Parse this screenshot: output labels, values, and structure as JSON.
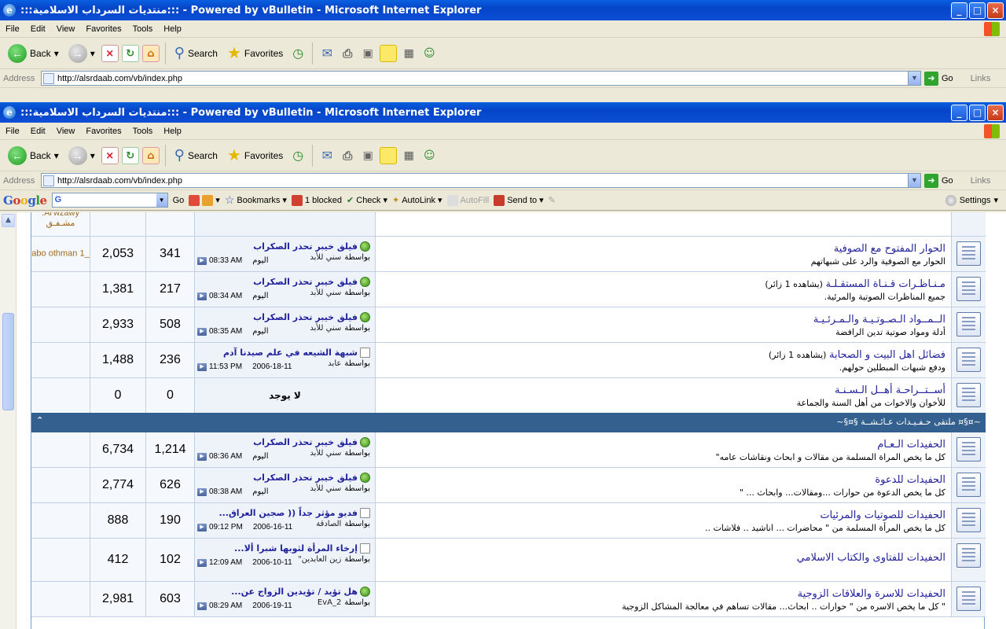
{
  "window": {
    "title": ":::منتديات السرداب الاسلامية::: - Powered by vBulletin - Microsoft Internet Explorer",
    "controls": {
      "minimize": "_",
      "maximize": "□",
      "close": "×"
    }
  },
  "menu": [
    "File",
    "Edit",
    "View",
    "Favorites",
    "Tools",
    "Help"
  ],
  "toolbar": {
    "back": "Back",
    "search": "Search",
    "favorites": "Favorites"
  },
  "address": {
    "label": "Address",
    "url": "http://alsrdaab.com/vb/index.php",
    "go": "Go",
    "links": "Links"
  },
  "googlebar": {
    "logo": "Google",
    "search_value": "G",
    "go": "Go",
    "bookmarks": "Bookmarks",
    "blocked": "1 blocked",
    "check": "Check",
    "autolink": "AutoLink",
    "autofill": "AutoFill",
    "sendto": "Send to",
    "settings": "Settings"
  },
  "forum": {
    "top_partial_mod": ".Al'wzawy مشـفـق",
    "rows_group1": [
      {
        "name": "الحوار المفتوح مع الصوفية",
        "viewers": "",
        "desc": "الحوار مع الصوفية والرد على شبهاتهم",
        "last_title": "فيلق خيبر تحذر الصكراب",
        "last_by": "سني للأبد",
        "last_by_prefix": "بواسطة",
        "last_day": "اليوم",
        "last_time": "08:33 AM",
        "threads": "341",
        "posts": "2,053",
        "mod": "abo othman 1_"
      },
      {
        "name": "مـنـاظـرات قـنـاة المستقـلـة",
        "viewers": "(يشاهده 1 زائر)",
        "desc": "جميع المناظرات الصوتية والمرئية.",
        "last_title": "فيلق خيبر تحذر الصكراب",
        "last_by": "سني للأبد",
        "last_by_prefix": "بواسطة",
        "last_day": "اليوم",
        "last_time": "08:34 AM",
        "threads": "217",
        "posts": "1,381",
        "mod": ""
      },
      {
        "name": "الــمــواد الـصـوتـيـة والـمـرئـيـة",
        "viewers": "",
        "desc": "أدلة ومواد صوتية تدين الرافضة",
        "last_title": "فيلق خيبر تحذر الصكراب",
        "last_by": "سني للأبد",
        "last_by_prefix": "بواسطة",
        "last_day": "اليوم",
        "last_time": "08:35 AM",
        "threads": "508",
        "posts": "2,933",
        "mod": ""
      },
      {
        "name": "فضائل اهل البيت و الصحابة",
        "viewers": "(يشاهده 1 زائر)",
        "desc": "ودفع شبهات المبطلين حولهم.",
        "last_title": "شبهة الشيعه في علم صيدنا آدم",
        "last_by": "عابد",
        "last_by_prefix": "بواسطة",
        "last_day": "2006-18-11",
        "last_time": "11:53 PM",
        "threads": "236",
        "posts": "1,488",
        "mod": "",
        "doc_icon": true
      },
      {
        "name": "أســتــراحـة أهــل الـسـنـة",
        "viewers": "",
        "desc": "للأخوان والاخوات من أهل السنة والجماعة",
        "none": "لا يوجد",
        "threads": "0",
        "posts": "0",
        "mod": ""
      }
    ],
    "category": {
      "title": "~¤§¤ ملتقى حـفـيـدات عـائـشــة §¤§~",
      "collapse": "⌃"
    },
    "rows_group2": [
      {
        "name": "الحفيدات الـعـام",
        "desc": "كل ما يخص المراة المسلمة من مقالات و ابحاث ونقاشات عامه\"",
        "last_title": "فيلق خيبر تحذر الصكراب",
        "last_by": "سني للأبد",
        "last_by_prefix": "بواسطة",
        "last_day": "اليوم",
        "last_time": "08:36 AM",
        "threads": "1,214",
        "posts": "6,734"
      },
      {
        "name": "الحفيدات للدعوة",
        "desc": "كل ما يخص الدعوة من حوارات ...ومقالات... وابحاث ... \"",
        "last_title": "فيلق خيبر تحذر الصكراب",
        "last_by": "سني للأبد",
        "last_by_prefix": "بواسطة",
        "last_day": "اليوم",
        "last_time": "08:38 AM",
        "threads": "626",
        "posts": "2,774"
      },
      {
        "name": "الحفيدات للصوتيات والمرئيات",
        "desc": "كل ما يخص المرأة المسلمة من \" محاضرات ... اناشيد .. فلاشات ..",
        "last_title": "فديو مؤثر جداً (( صجين العراق...",
        "last_by": "الصادقة",
        "last_by_prefix": "بواسطة",
        "last_day": "2006-16-11",
        "last_time": "09:12 PM",
        "threads": "190",
        "posts": "888",
        "doc_icon": true
      },
      {
        "name": "الحفيدات للفتاوى والكتاب الاسلامي",
        "desc": "",
        "last_title": "إرخاء المرأة لثوبها شبرا ألا...",
        "last_by": "زين العابدين\"",
        "last_by_prefix": "بواسطة",
        "last_day": "2006-10-11",
        "last_time": "12:09 AM",
        "threads": "102",
        "posts": "412",
        "doc_icon": true
      },
      {
        "name": "الحفيدات للاسرة والعلاقات الزوجية",
        "desc": "\" كل ما يخص الاسره من \" حوارات .. ابحاث... مقالات تساهم في معالجة المشاكل الزوجية",
        "last_title": "هل تؤيد / تؤيدين الزواج عن...",
        "last_by": "EvA_2",
        "last_by_prefix": "بواسطة",
        "last_day": "2006-19-11",
        "last_time": "08:29 AM",
        "threads": "603",
        "posts": "2,981"
      }
    ]
  }
}
